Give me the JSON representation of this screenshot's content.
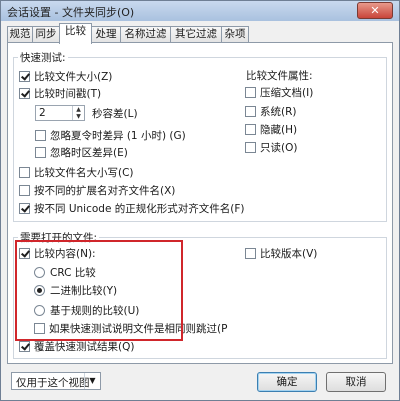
{
  "window": {
    "title": "会话设置 - 文件夹同步(O)",
    "close_label": "✕"
  },
  "tabs": [
    {
      "label": "规范"
    },
    {
      "label": "同步"
    },
    {
      "label": "比较"
    },
    {
      "label": "处理"
    },
    {
      "label": "名称过滤"
    },
    {
      "label": "其它过滤"
    },
    {
      "label": "杂项"
    }
  ],
  "active_tab": "比较",
  "quick_test": {
    "label": "快速测试:",
    "compare_size": {
      "label": "比较文件大小(Z)",
      "checked": true
    },
    "compare_time": {
      "label": "比较时间戳(T)",
      "checked": true
    },
    "seconds": {
      "value": "2",
      "suffix": "秒容差(L)"
    },
    "ignore_dst": {
      "label": "忽略夏令时差异 (1 小时) (G)",
      "checked": false
    },
    "ignore_timezone": {
      "label": "忽略时区差异(E)",
      "checked": false
    },
    "compare_case": {
      "label": "比较文件名大小写(C)",
      "checked": false
    },
    "align_ext": {
      "label": "按不同的扩展名对齐文件名(X)",
      "checked": false
    },
    "align_unicode": {
      "label": "按不同 Unicode 的正规化形式对齐文件名(F)",
      "checked": true
    }
  },
  "attributes": {
    "label": "比较文件属性:",
    "items": [
      {
        "label": "压缩文档(I)",
        "checked": false
      },
      {
        "label": "系统(R)",
        "checked": false
      },
      {
        "label": "隐藏(H)",
        "checked": false
      },
      {
        "label": "只读(O)",
        "checked": false
      }
    ]
  },
  "open_files": {
    "label": "需要打开的文件:",
    "compare_content": {
      "label": "比较内容(N):",
      "checked": true
    },
    "radios": [
      {
        "label": "CRC 比较",
        "selected": false
      },
      {
        "label": "二进制比较(Y)",
        "selected": true
      },
      {
        "label": "基于规则的比较(U)",
        "selected": false
      }
    ],
    "if_quick": {
      "label": "如果快速测试说明文件是相同则跳过(P",
      "checked": false
    },
    "compare_version": {
      "label": "比较版本(V)",
      "checked": false
    },
    "override_quick": {
      "label": "覆盖快速测试结果(Q)",
      "checked": true
    }
  },
  "footer": {
    "scope_select": "仅用于这个视图",
    "ok": "确定",
    "cancel": "取消"
  },
  "colors": {
    "highlight_border": "#d0262b",
    "title_gradient": "#a9c1df"
  }
}
